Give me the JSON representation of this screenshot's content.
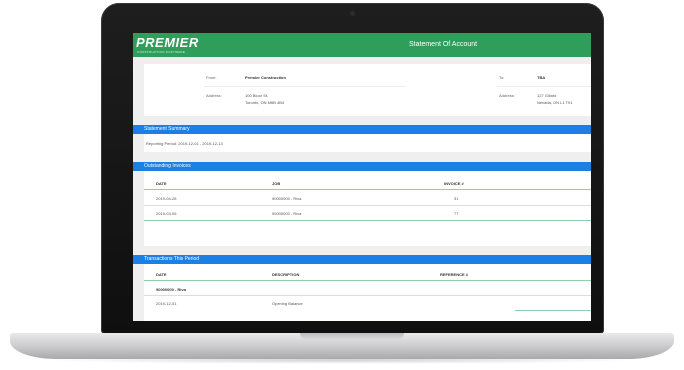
{
  "app": {
    "logo": "PREMIER",
    "logo_sub": "CONSTRUCTION SOFTWARE",
    "title": "Statement Of Account"
  },
  "header": {
    "from_label": "From:",
    "from_value": "Premier Construction",
    "address_label": "Address:",
    "address_line1": "100 Bloor St.",
    "address_line2": "Toronto, ON M6B 4B4",
    "to_label": "To:",
    "to_value": "TBA",
    "to_address_label": "Address:",
    "to_address_line1": "127 Gillard",
    "to_address_line2": "Nevada, ON L1 T91"
  },
  "summary": {
    "title": "Statement Summary",
    "reporting_period": "Reporting Period:  2019-12-01 - 2019-12-13"
  },
  "invoices": {
    "title": "Outstanding Invoices",
    "columns": [
      "DATE",
      "JOB",
      "INVOICE #"
    ],
    "rows": [
      {
        "date": "2019-04-28",
        "job": "90000000 - Riva",
        "invoice": "31"
      },
      {
        "date": "2019-03-05",
        "job": "90000000 - Riva",
        "invoice": "77"
      }
    ]
  },
  "transactions": {
    "title": "Transactions This Period",
    "columns": [
      "DATE",
      "DESCRIPTION",
      "REFERENCE #"
    ],
    "group": "90000000 - Riva",
    "rows": [
      {
        "date": "2019-12-01",
        "description": "Opening Balance",
        "reference": ""
      }
    ]
  },
  "colors": {
    "brand_green": "#2f9e5a",
    "section_blue": "#1b7fe6"
  }
}
